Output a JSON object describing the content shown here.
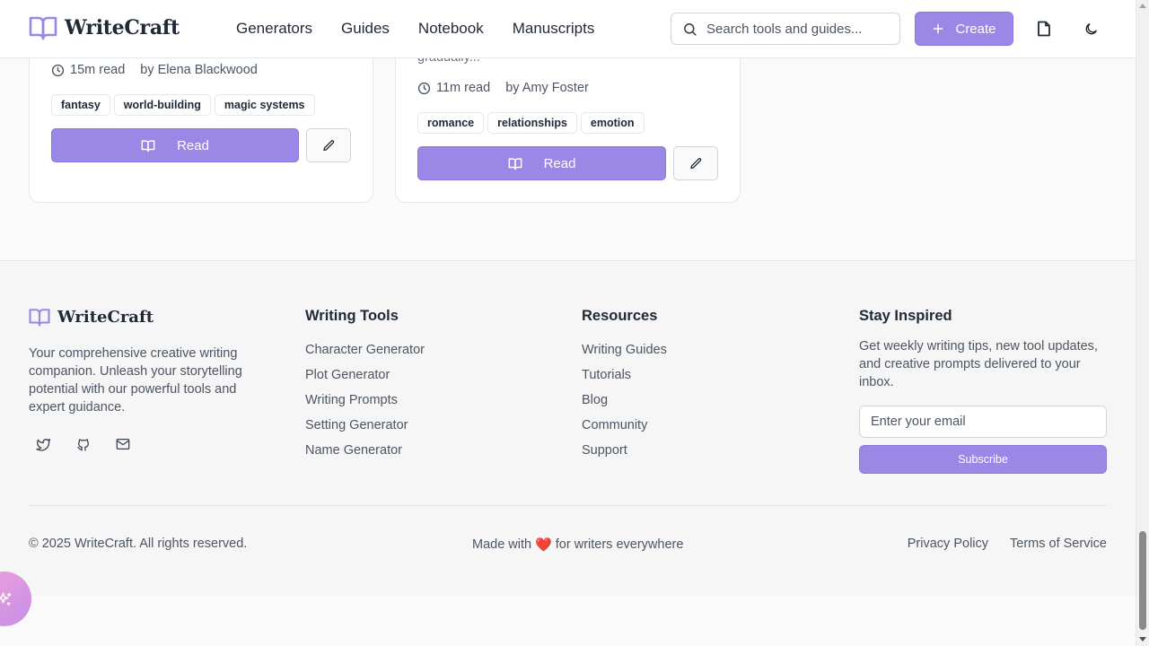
{
  "brand": {
    "name": "WriteCraft",
    "accent": "#9b87e5"
  },
  "header": {
    "nav": [
      "Generators",
      "Guides",
      "Notebook",
      "Manuscripts"
    ],
    "search_placeholder": "Search tools and guides...",
    "create_label": "Create",
    "icons": [
      "search-icon",
      "plus-icon",
      "document-icon",
      "moon-icon"
    ]
  },
  "cards": [
    {
      "read_time": "15m read",
      "author": "by Elena Blackwood",
      "tags": [
        "fantasy",
        "world-building",
        "magic systems"
      ],
      "read_label": "Read"
    },
    {
      "excerpt_fragment": "gradually...",
      "read_time": "11m read",
      "author": "by Amy Foster",
      "tags": [
        "romance",
        "relationships",
        "emotion"
      ],
      "read_label": "Read"
    }
  ],
  "footer": {
    "brand": "WriteCraft",
    "description": "Your comprehensive creative writing companion. Unleash your storytelling potential with our powerful tools and expert guidance.",
    "social_icons": [
      "twitter-icon",
      "github-icon",
      "mail-icon"
    ],
    "writing_tools": {
      "title": "Writing Tools",
      "links": [
        "Character Generator",
        "Plot Generator",
        "Writing Prompts",
        "Setting Generator",
        "Name Generator"
      ]
    },
    "resources": {
      "title": "Resources",
      "links": [
        "Writing Guides",
        "Tutorials",
        "Blog",
        "Community",
        "Support"
      ]
    },
    "stay_inspired": {
      "title": "Stay Inspired",
      "description": "Get weekly writing tips, new tool updates, and creative prompts delivered to your inbox.",
      "email_placeholder": "Enter your email",
      "subscribe_label": "Subscribe"
    },
    "copyright": "© 2025 WriteCraft. All rights reserved.",
    "made_with_prefix": "Made with",
    "made_with_heart": "❤️",
    "made_with_suffix": "for writers everywhere",
    "legal": [
      "Privacy Policy",
      "Terms of Service"
    ]
  }
}
